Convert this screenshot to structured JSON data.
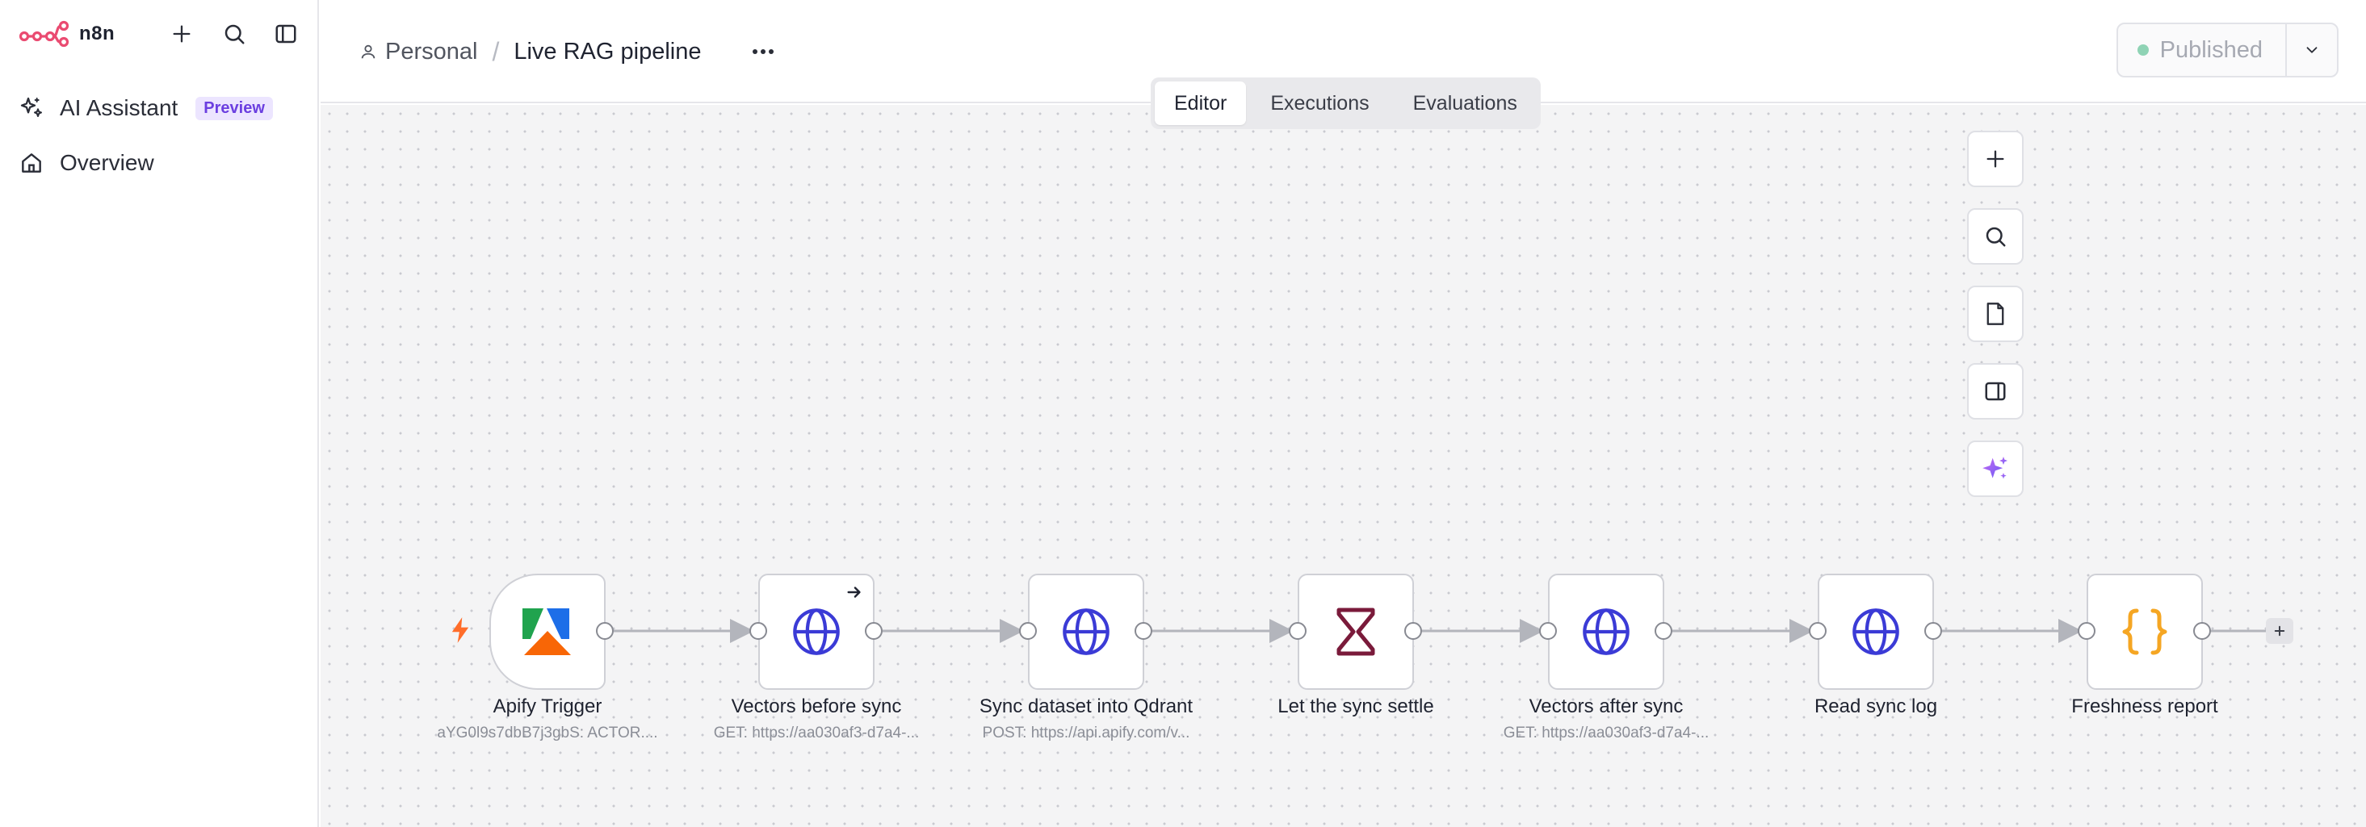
{
  "brand": {
    "name": "n8n",
    "accent": "#ea4b71"
  },
  "sidebar": {
    "items": [
      {
        "label": "AI Assistant",
        "badge": "Preview",
        "icon": "sparkles-icon"
      },
      {
        "label": "Overview",
        "icon": "home-icon"
      }
    ]
  },
  "header": {
    "project": "Personal",
    "workflow_name": "Live RAG pipeline",
    "tabs": [
      {
        "label": "Editor",
        "active": true
      },
      {
        "label": "Executions",
        "active": false
      },
      {
        "label": "Evaluations",
        "active": false
      }
    ],
    "publish_label": "Published",
    "publish_status_color": "#8fd3b5"
  },
  "nodes": [
    {
      "name": "Apify Trigger",
      "subtitle": "aYG0l9s7dbB7j3gbS: ACTOR....",
      "icon": "apify-logo"
    },
    {
      "name": "Vectors before sync",
      "subtitle": "GET: https://aa030af3-d7a4-...",
      "icon": "globe-icon"
    },
    {
      "name": "Sync dataset into Qdrant",
      "subtitle": "POST: https://api.apify.com/v...",
      "icon": "globe-icon"
    },
    {
      "name": "Let the sync settle",
      "subtitle": "",
      "icon": "hourglass-icon"
    },
    {
      "name": "Vectors after sync",
      "subtitle": "GET: https://aa030af3-d7a4-...",
      "icon": "globe-icon"
    },
    {
      "name": "Read sync log",
      "subtitle": "",
      "icon": "globe-icon"
    },
    {
      "name": "Freshness report",
      "subtitle": "",
      "icon": "code-braces-icon"
    }
  ],
  "colors": {
    "http_icon": "#3b3bd6",
    "wait_icon": "#7a1a3a",
    "code_icon": "#f5a623",
    "trigger_bolt": "#ff6d2a"
  }
}
